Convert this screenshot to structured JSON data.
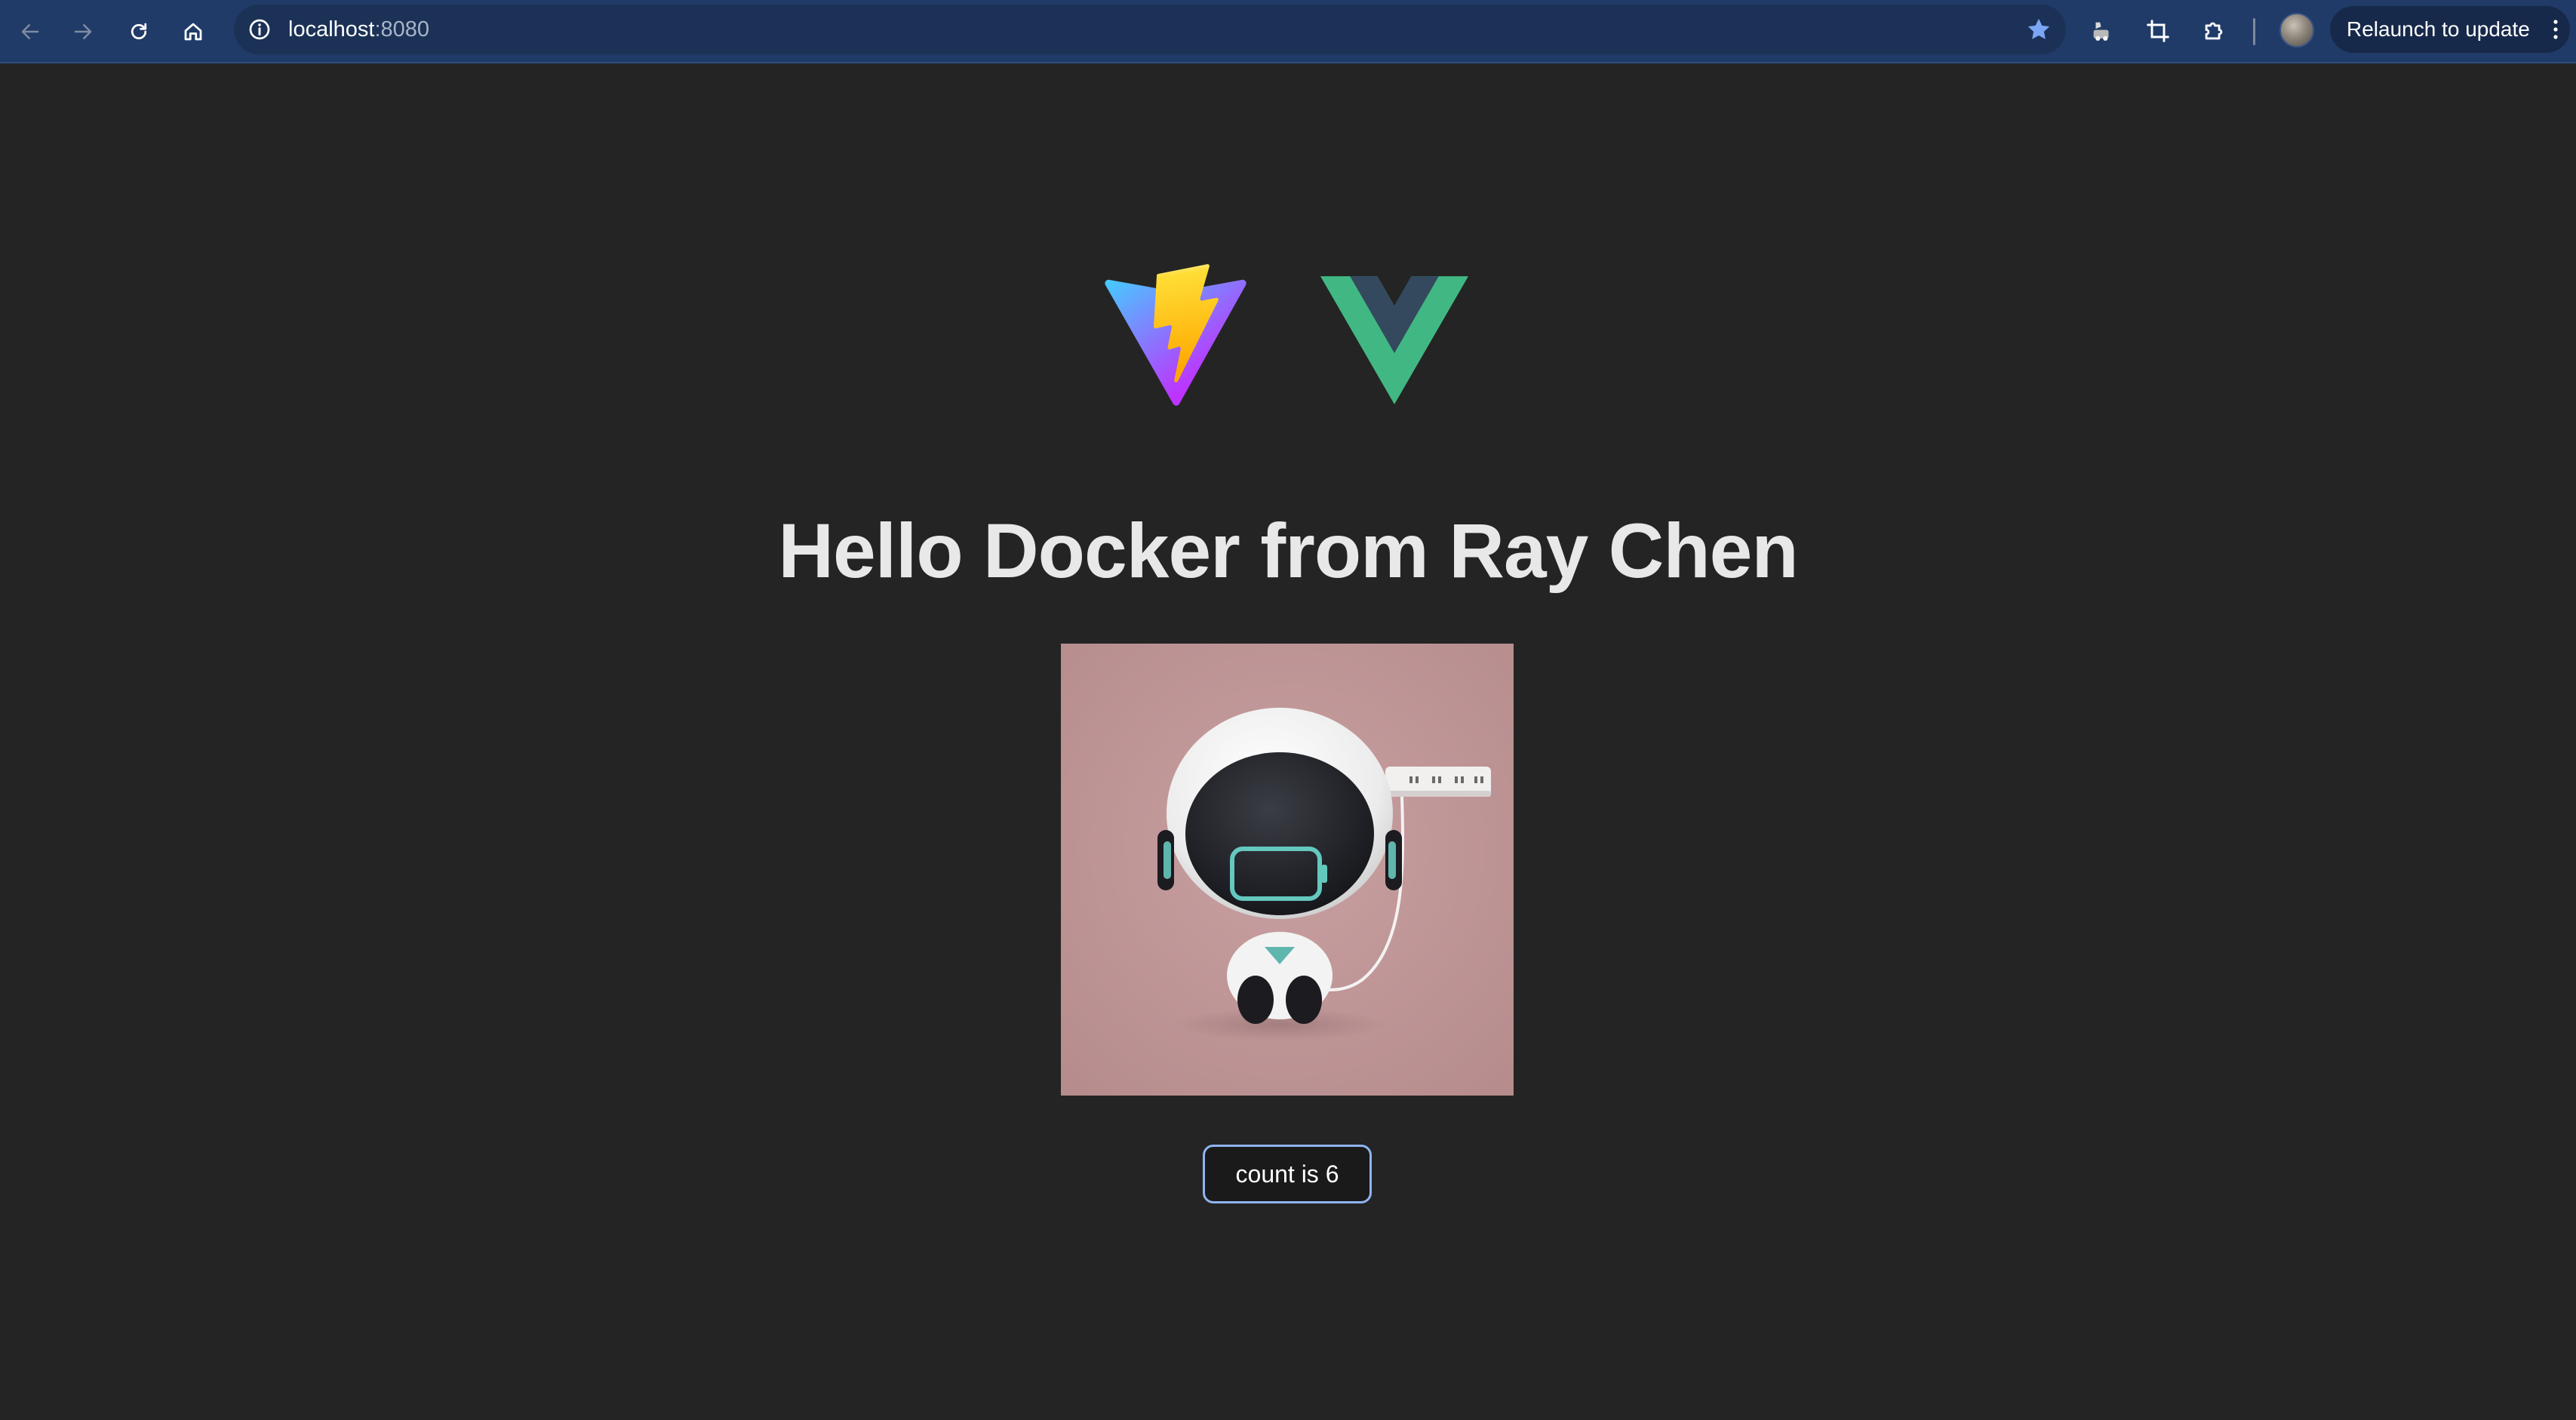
{
  "browser": {
    "url_host": "localhost",
    "url_port": ":8080",
    "relaunch_label": "Relaunch to update",
    "accent_color": "#213b68"
  },
  "icons": [
    "back-arrow-icon",
    "forward-arrow-icon",
    "reload-icon",
    "home-icon",
    "site-info-icon",
    "bookmark-star-icon",
    "tab-search-icon",
    "screenshot-icon",
    "extensions-icon",
    "profile-avatar",
    "more-menu-icon"
  ],
  "page": {
    "heading": "Hello Docker from Ray Chen",
    "count_label": "count is 6",
    "count_value": 6,
    "background_color": "#242424",
    "logos": [
      "vite-logo",
      "vue-logo"
    ],
    "image": "robot-charging-photo"
  }
}
